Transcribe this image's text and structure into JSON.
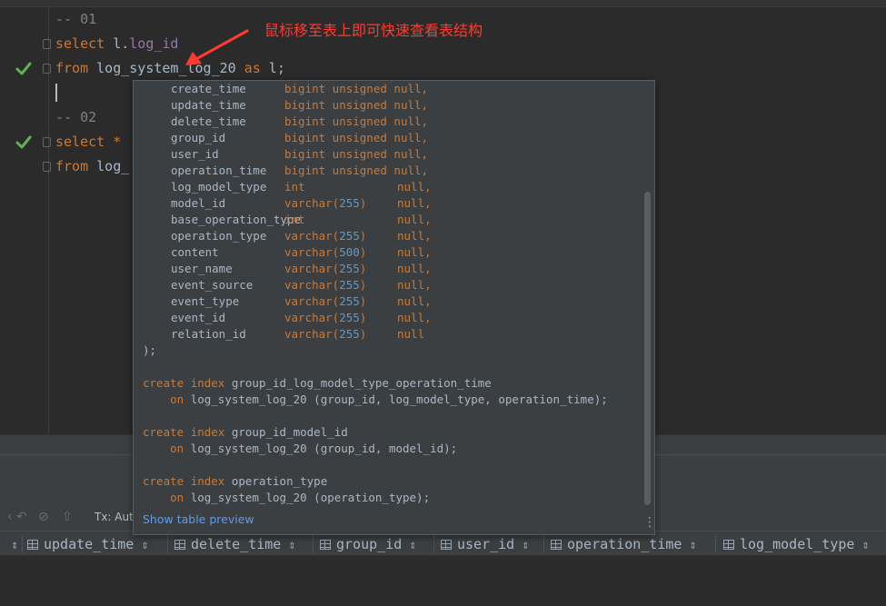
{
  "annotation": "鼠标移至表上即可快速查看表结构",
  "editor": {
    "line1": "-- 01",
    "line2_kw": "select",
    "line2_rest": " l.",
    "line2_field": "log_id",
    "line3_kw": "from",
    "line3_table": " log_system_log_20 ",
    "line3_as": "as",
    "line3_alias": " l;",
    "line5": "-- 02",
    "line6_kw": "select",
    "line6_rest": " *",
    "line7_kw": "from",
    "line7_rest": " log_"
  },
  "popup": {
    "columns": [
      {
        "name": "create_time",
        "type": "bigint unsigned",
        "null": "null,"
      },
      {
        "name": "update_time",
        "type": "bigint unsigned",
        "null": "null,"
      },
      {
        "name": "delete_time",
        "type": "bigint unsigned",
        "null": "null,"
      },
      {
        "name": "group_id",
        "type": "bigint unsigned",
        "null": "null,"
      },
      {
        "name": "user_id",
        "type": "bigint unsigned",
        "null": "null,"
      },
      {
        "name": "operation_time",
        "type": "bigint unsigned",
        "null": "null,"
      },
      {
        "name": "log_model_type",
        "type": "int",
        "null": "null,"
      },
      {
        "name": "model_id",
        "type": "varchar(255)",
        "null": "null,"
      },
      {
        "name": "base_operation_type",
        "type": "int",
        "null": "null,"
      },
      {
        "name": "operation_type",
        "type": "varchar(255)",
        "null": "null,"
      },
      {
        "name": "content",
        "type": "varchar(500)",
        "null": "null,"
      },
      {
        "name": "user_name",
        "type": "varchar(255)",
        "null": "null,"
      },
      {
        "name": "event_source",
        "type": "varchar(255)",
        "null": "null,"
      },
      {
        "name": "event_type",
        "type": "varchar(255)",
        "null": "null,"
      },
      {
        "name": "event_id",
        "type": "varchar(255)",
        "null": "null,"
      },
      {
        "name": "relation_id",
        "type": "varchar(255)",
        "null": "null"
      }
    ],
    "close_paren": ");",
    "indexes": [
      {
        "kw1": "create",
        "kw2": "index",
        "name": "group_id_log_model_type_operation_time",
        "on": "on",
        "target": "log_system_log_20 (group_id, log_model_type, operation_time);"
      },
      {
        "kw1": "create",
        "kw2": "index",
        "name": "group_id_model_id",
        "on": "on",
        "target": "log_system_log_20 (group_id, model_id);"
      },
      {
        "kw1": "create",
        "kw2": "index",
        "name": "operation_type",
        "on": "on",
        "target": "log_system_log_20 (operation_type);"
      }
    ],
    "show_preview": "Show table preview",
    "more_icon": "⋮"
  },
  "toolbar": {
    "tx_label": "Tx: Auto"
  },
  "result_columns": [
    "update_time",
    "delete_time",
    "group_id",
    "user_id",
    "operation_time",
    "log_model_type"
  ],
  "colors": {
    "keyword": "#cc7832",
    "annotation": "#ff3b2f",
    "link": "#589df6",
    "check": "#5fb356"
  }
}
